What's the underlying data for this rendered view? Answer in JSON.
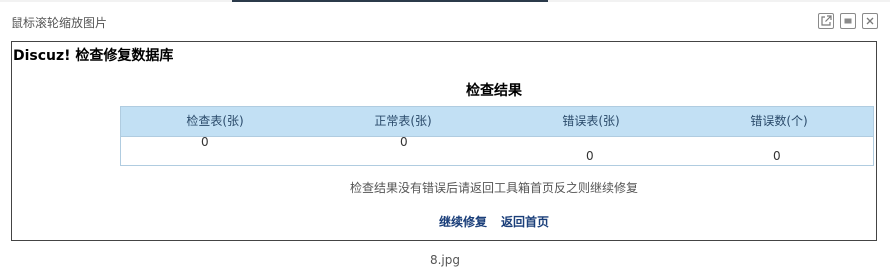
{
  "viewer": {
    "title": "鼠标滚轮缩放图片",
    "filename": "8.jpg",
    "controls": [
      {
        "name": "open-external-icon",
        "label": ""
      },
      {
        "name": "maximize-icon",
        "label": ""
      },
      {
        "name": "close-icon",
        "label": ""
      }
    ]
  },
  "page": {
    "heading": "Discuz! 检查修复数据库",
    "result_title": "检查结果",
    "table": {
      "headers": [
        "检查表(张)",
        "正常表(张)",
        "错误表(张)",
        "错误数(个)"
      ],
      "values": [
        "0",
        "0",
        "0",
        "0"
      ]
    },
    "note": "检查结果没有错误后请返回工具箱首页反之则继续修复",
    "links": {
      "continue": "继续修复",
      "home": "返回首页"
    }
  },
  "colors": {
    "table_header_bg": "#c2e0f4",
    "link": "#1b3f7a"
  }
}
